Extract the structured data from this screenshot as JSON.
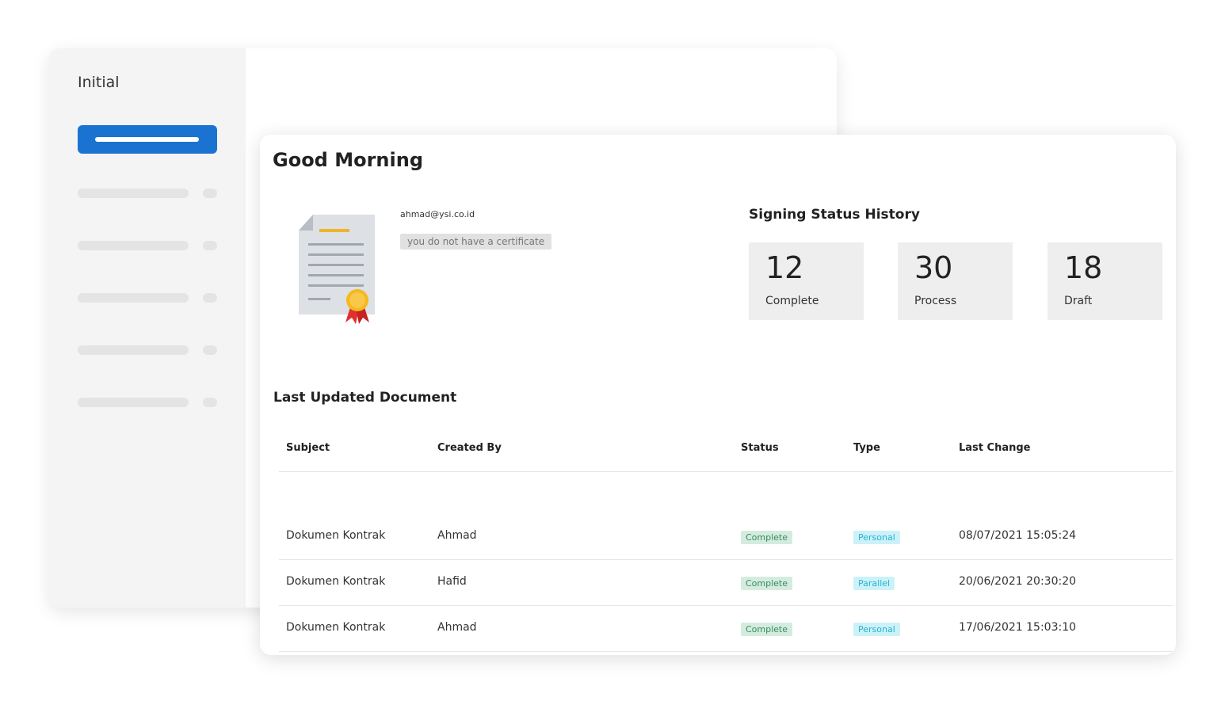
{
  "sidebar": {
    "title": "Initial"
  },
  "main": {
    "greeting": "Good Morning",
    "user": {
      "email": "ahmad@ysi.co.id",
      "certificate_status": "you do not have a certificate"
    },
    "signing_status": {
      "title": "Signing Status History",
      "stats": [
        {
          "value": "12",
          "label": "Complete"
        },
        {
          "value": "30",
          "label": "Process"
        },
        {
          "value": "18",
          "label": "Draft"
        }
      ]
    },
    "documents": {
      "title": "Last Updated Document",
      "columns": [
        "Subject",
        "Created By",
        "Status",
        "Type",
        "Last Change"
      ],
      "rows": [
        {
          "subject": "Dokumen Kontrak",
          "created_by": "Ahmad",
          "status": "Complete",
          "type": "Personal",
          "last_change": "08/07/2021 15:05:24"
        },
        {
          "subject": "Dokumen Kontrak",
          "created_by": "Hafid",
          "status": "Complete",
          "type": "Parallel",
          "last_change": "20/06/2021 20:30:20"
        },
        {
          "subject": "Dokumen Kontrak",
          "created_by": "Ahmad",
          "status": "Complete",
          "type": "Personal",
          "last_change": "17/06/2021 15:03:10"
        }
      ]
    }
  },
  "colors": {
    "accent": "#1a73d1",
    "status_complete_bg": "#d3ecdf",
    "status_complete_text": "#3a8a5e",
    "type_bg": "#cdf1f8",
    "type_text": "#23b4d4"
  },
  "icons": {
    "certificate": "certificate-icon"
  }
}
